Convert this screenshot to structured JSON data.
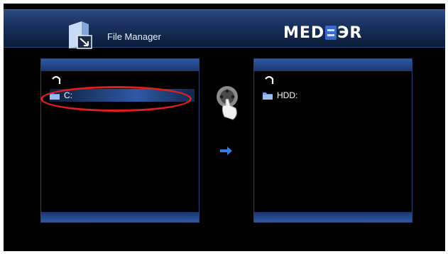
{
  "header": {
    "app_icon": "file-manager-icon",
    "title": "File Manager",
    "brand": {
      "left": "MED",
      "right": "ЭR"
    }
  },
  "left_panel": {
    "up_icon": "parent-folder-icon",
    "items": [
      {
        "icon": "folder-icon",
        "label": "C:",
        "selected": true
      }
    ]
  },
  "right_panel": {
    "up_icon": "parent-folder-icon",
    "items": [
      {
        "icon": "folder-icon",
        "label": "HDD:",
        "selected": false
      }
    ]
  },
  "center": {
    "remote_icon": "remote-hand-icon",
    "arrow_icon": "arrow-right-icon"
  },
  "annotation": {
    "color": "#e01e1e"
  },
  "colors": {
    "header_bg": "#18305c",
    "panel_bar": "#2f58a0",
    "accent": "#3a6ad0"
  }
}
